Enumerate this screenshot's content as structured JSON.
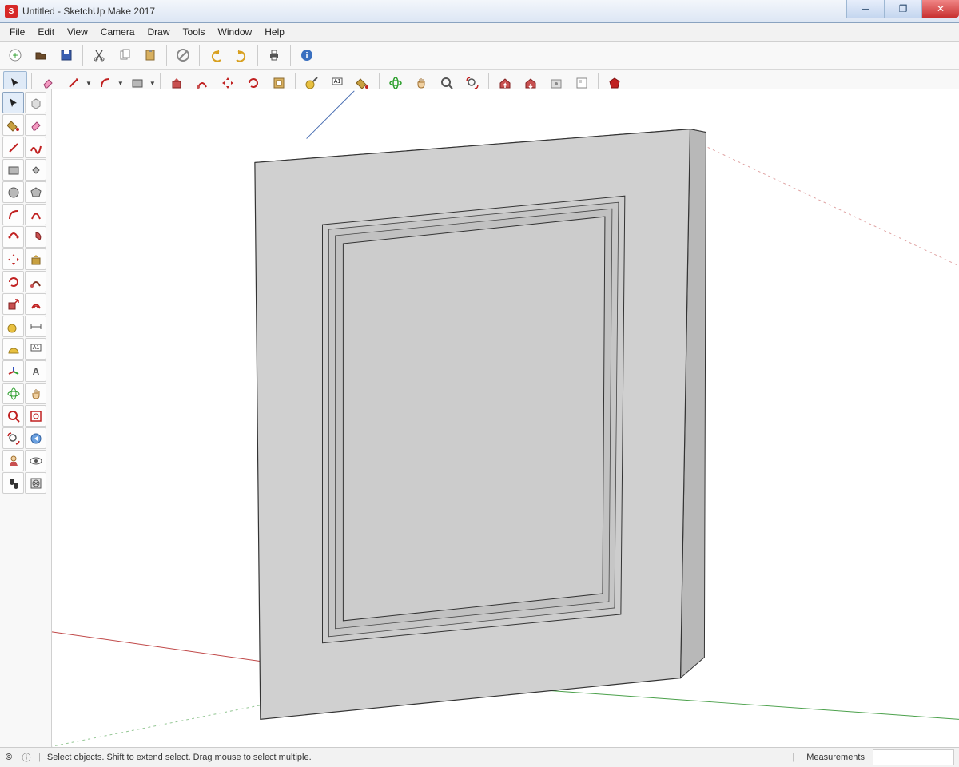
{
  "window": {
    "title": "Untitled - SketchUp Make 2017"
  },
  "menubar": [
    "File",
    "Edit",
    "View",
    "Camera",
    "Draw",
    "Tools",
    "Window",
    "Help"
  ],
  "toolbar_row1": [
    {
      "name": "new-file-icon"
    },
    {
      "name": "open-file-icon"
    },
    {
      "name": "save-icon"
    },
    {
      "sep": true
    },
    {
      "name": "cut-icon"
    },
    {
      "name": "copy-icon"
    },
    {
      "name": "paste-icon"
    },
    {
      "sep": true
    },
    {
      "name": "delete-icon"
    },
    {
      "sep": true
    },
    {
      "name": "undo-icon"
    },
    {
      "name": "redo-icon"
    },
    {
      "sep": true
    },
    {
      "name": "print-icon"
    },
    {
      "sep": true
    },
    {
      "name": "model-info-icon"
    }
  ],
  "toolbar_row2": [
    {
      "name": "select-tool-icon",
      "selected": true
    },
    {
      "sep": true
    },
    {
      "name": "eraser-tool-icon"
    },
    {
      "name": "line-tool-icon",
      "dd": true
    },
    {
      "name": "arc-tool-icon",
      "dd": true
    },
    {
      "name": "rectangle-tool-icon",
      "dd": true
    },
    {
      "sep": true
    },
    {
      "name": "pushpull-tool-icon"
    },
    {
      "name": "followme-tool-icon"
    },
    {
      "name": "move-tool-icon"
    },
    {
      "name": "rotate-tool-icon"
    },
    {
      "name": "offset-tool-icon"
    },
    {
      "sep": true
    },
    {
      "name": "tape-measure-icon"
    },
    {
      "name": "text-label-icon"
    },
    {
      "name": "paint-bucket-icon"
    },
    {
      "sep": true
    },
    {
      "name": "orbit-tool-icon"
    },
    {
      "name": "pan-tool-icon"
    },
    {
      "name": "zoom-tool-icon"
    },
    {
      "name": "zoom-extents-icon"
    },
    {
      "sep": true
    },
    {
      "name": "warehouse-upload-icon"
    },
    {
      "name": "warehouse-get-icon"
    },
    {
      "name": "extension-warehouse-icon"
    },
    {
      "name": "layout-icon"
    },
    {
      "sep": true
    },
    {
      "name": "ruby-console-icon"
    }
  ],
  "left_toolbox": [
    {
      "name": "select-icon",
      "active": true
    },
    {
      "name": "make-component-icon"
    },
    {
      "name": "paint-bucket-icon"
    },
    {
      "name": "eraser-icon"
    },
    {
      "name": "line-icon"
    },
    {
      "name": "freehand-icon"
    },
    {
      "name": "rectangle-icon"
    },
    {
      "name": "rotated-rect-icon"
    },
    {
      "name": "circle-icon"
    },
    {
      "name": "polygon-icon"
    },
    {
      "name": "arc-icon"
    },
    {
      "name": "2pt-arc-icon"
    },
    {
      "name": "3pt-arc-icon"
    },
    {
      "name": "pie-icon"
    },
    {
      "name": "move-icon"
    },
    {
      "name": "pushpull-icon"
    },
    {
      "name": "rotate-icon"
    },
    {
      "name": "followme-icon"
    },
    {
      "name": "scale-icon"
    },
    {
      "name": "offset-icon"
    },
    {
      "name": "tape-icon"
    },
    {
      "name": "dimension-icon"
    },
    {
      "name": "protractor-icon"
    },
    {
      "name": "text-icon"
    },
    {
      "name": "axes-icon"
    },
    {
      "name": "3dtext-icon"
    },
    {
      "name": "orbit-icon"
    },
    {
      "name": "pan-icon"
    },
    {
      "name": "zoom-icon"
    },
    {
      "name": "zoom-window-icon"
    },
    {
      "name": "zoom-extents-icon"
    },
    {
      "name": "previous-view-icon"
    },
    {
      "name": "position-camera-icon"
    },
    {
      "name": "look-around-icon"
    },
    {
      "name": "walk-icon"
    },
    {
      "name": "section-plane-icon"
    }
  ],
  "statusbar": {
    "message": "Select objects. Shift to extend select. Drag mouse to select multiple.",
    "measurements_label": "Measurements",
    "measurements_value": ""
  }
}
